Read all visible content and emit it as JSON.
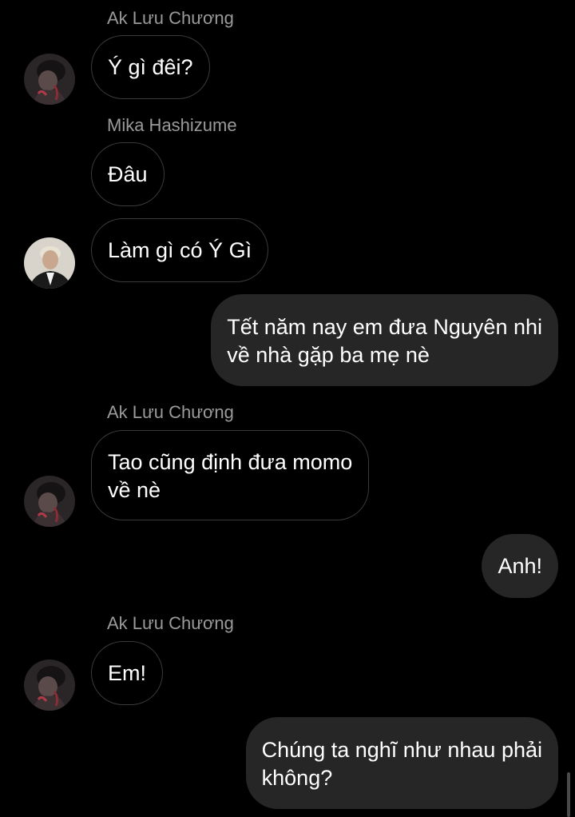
{
  "colors": {
    "background": "#000000",
    "incoming_bubble_border": "#3a3a3a",
    "outgoing_bubble_fill": "#262626",
    "sender_name": "#9a9a9a",
    "text": "#ffffff"
  },
  "messages": [
    {
      "sender": "Ak Lưu Chương",
      "text": "Ý gì đêi?"
    },
    {
      "sender": "Mika Hashizume",
      "text": "Đâu"
    },
    {
      "text": "Làm gì có Ý Gì"
    },
    {
      "lines": [
        "Tết năm nay em đưa Nguyên nhi",
        "về nhà gặp ba mẹ nè"
      ]
    },
    {
      "sender": "Ak Lưu Chương",
      "lines": [
        "Tao cũng định đưa momo",
        "về nè"
      ]
    },
    {
      "text": "Anh!"
    },
    {
      "sender": "Ak Lưu Chương",
      "text": "Em!"
    },
    {
      "lines": [
        "Chúng ta nghĩ như nhau phải",
        "không?"
      ]
    }
  ]
}
